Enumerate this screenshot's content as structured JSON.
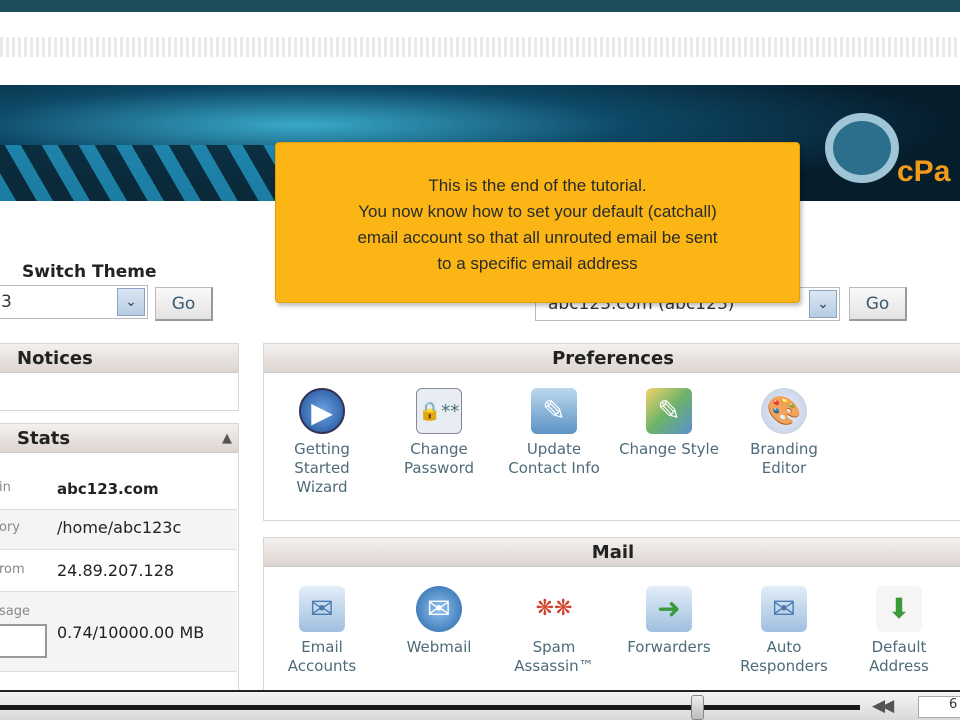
{
  "banner": {
    "logo_text": "cPa"
  },
  "tooltip": {
    "lines": [
      "This is the end of the tutorial.",
      "You now know how to set your default (catchall)",
      "email account so that all unrouted email be sent",
      "to a specific email address"
    ]
  },
  "theme": {
    "label": "Switch Theme",
    "value": "3",
    "go": "Go"
  },
  "domain_select": {
    "value": "abc123.com (abc123)",
    "go": "Go"
  },
  "notices": {
    "title": "Notices"
  },
  "stats": {
    "title": "Stats",
    "rows": [
      {
        "k": "in",
        "v": "abc123.com"
      },
      {
        "k": "ory",
        "v": "/home/abc123c"
      },
      {
        "k": "rom",
        "v": "24.89.207.128"
      },
      {
        "k": "sage",
        "v": "0.74/10000.00 MB"
      }
    ]
  },
  "preferences": {
    "title": "Preferences",
    "items": [
      {
        "label": "Getting Started Wizard",
        "icon": "play-icon"
      },
      {
        "label": "Change Password",
        "icon": "lock-icon"
      },
      {
        "label": "Update Contact Info",
        "icon": "contact-icon"
      },
      {
        "label": "Change Style",
        "icon": "style-icon"
      },
      {
        "label": "Branding Editor",
        "icon": "palette-icon"
      }
    ]
  },
  "mail": {
    "title": "Mail",
    "items": [
      {
        "label": "Email Accounts",
        "icon": "envelope-icon"
      },
      {
        "label": "Webmail",
        "icon": "webmail-icon"
      },
      {
        "label": "Spam Assassin™",
        "icon": "spam-icon"
      },
      {
        "label": "Forwarders",
        "icon": "forward-icon"
      },
      {
        "label": "Auto Responders",
        "icon": "autoresponder-icon"
      },
      {
        "label": "Default Address",
        "icon": "default-address-icon"
      }
    ]
  },
  "player": {
    "progress": 0.81,
    "time": "6"
  }
}
